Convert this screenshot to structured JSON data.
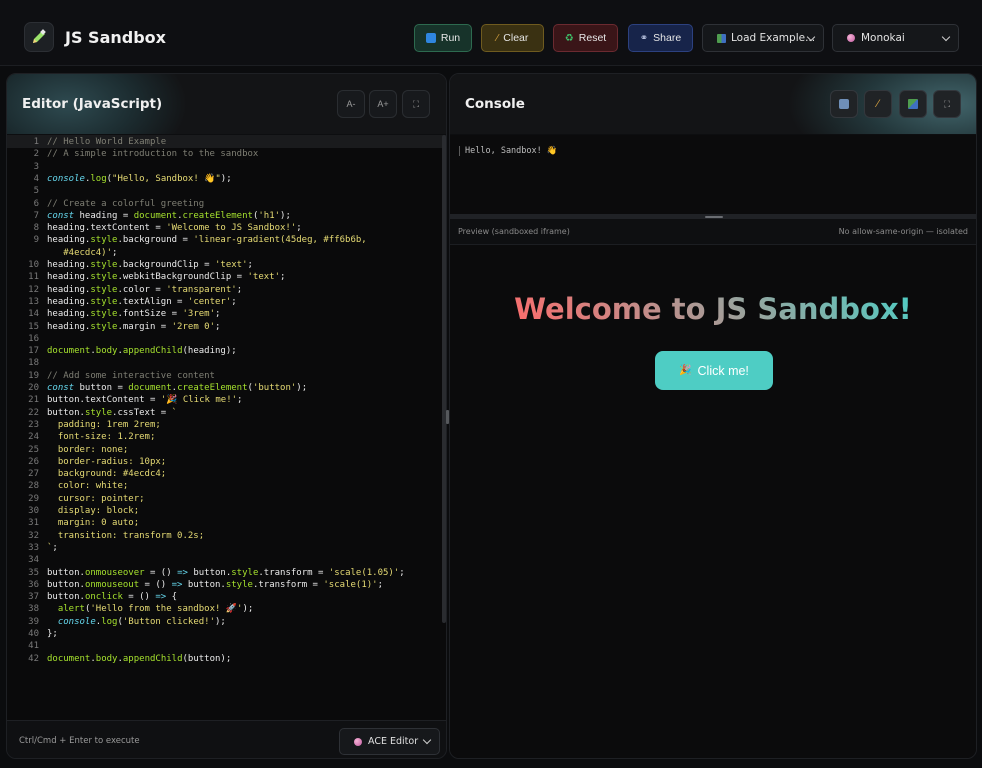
{
  "app": {
    "title": "JS Sandbox"
  },
  "toolbar": {
    "run_label": "Run",
    "clear_label": "Clear",
    "reset_label": "Reset",
    "share_label": "Share",
    "example_select": "Load Example...",
    "theme_select": "Monokai",
    "icons": {
      "logo": "pencil-icon",
      "run": "play-icon",
      "clear": "broom-icon",
      "reset": "recycle-icon",
      "share": "link-icon"
    }
  },
  "editor": {
    "title": "Editor (JavaScript)",
    "font_decrease": "A-",
    "font_increase": "A+",
    "footer_hint": "Ctrl/Cmd + Enter to execute",
    "mode_select": "ACE Editor",
    "line_numbers": [
      "1",
      "2",
      "3",
      "4",
      "5",
      "6",
      "7",
      "8",
      "9",
      "",
      "10",
      "11",
      "12",
      "13",
      "14",
      "15",
      "16",
      "17",
      "18",
      "19",
      "20",
      "21",
      "22",
      "23",
      "24",
      "25",
      "26",
      "27",
      "28",
      "29",
      "30",
      "31",
      "32",
      "33",
      "34",
      "35",
      "36",
      "37",
      "38",
      "39",
      "40",
      "41",
      "42"
    ]
  },
  "console": {
    "title": "Console",
    "output": [
      "Hello, Sandbox! 👋"
    ],
    "preview_label": "Preview (sandboxed iframe)",
    "preview_note": "No allow-same-origin — isolated"
  },
  "preview": {
    "heading": "Welcome to JS Sandbox!",
    "button_label": "Click me!"
  },
  "colors": {
    "gradient_start": "#ff6b6b",
    "gradient_end": "#4ecdc4",
    "button_bg": "#4ecdc4"
  }
}
